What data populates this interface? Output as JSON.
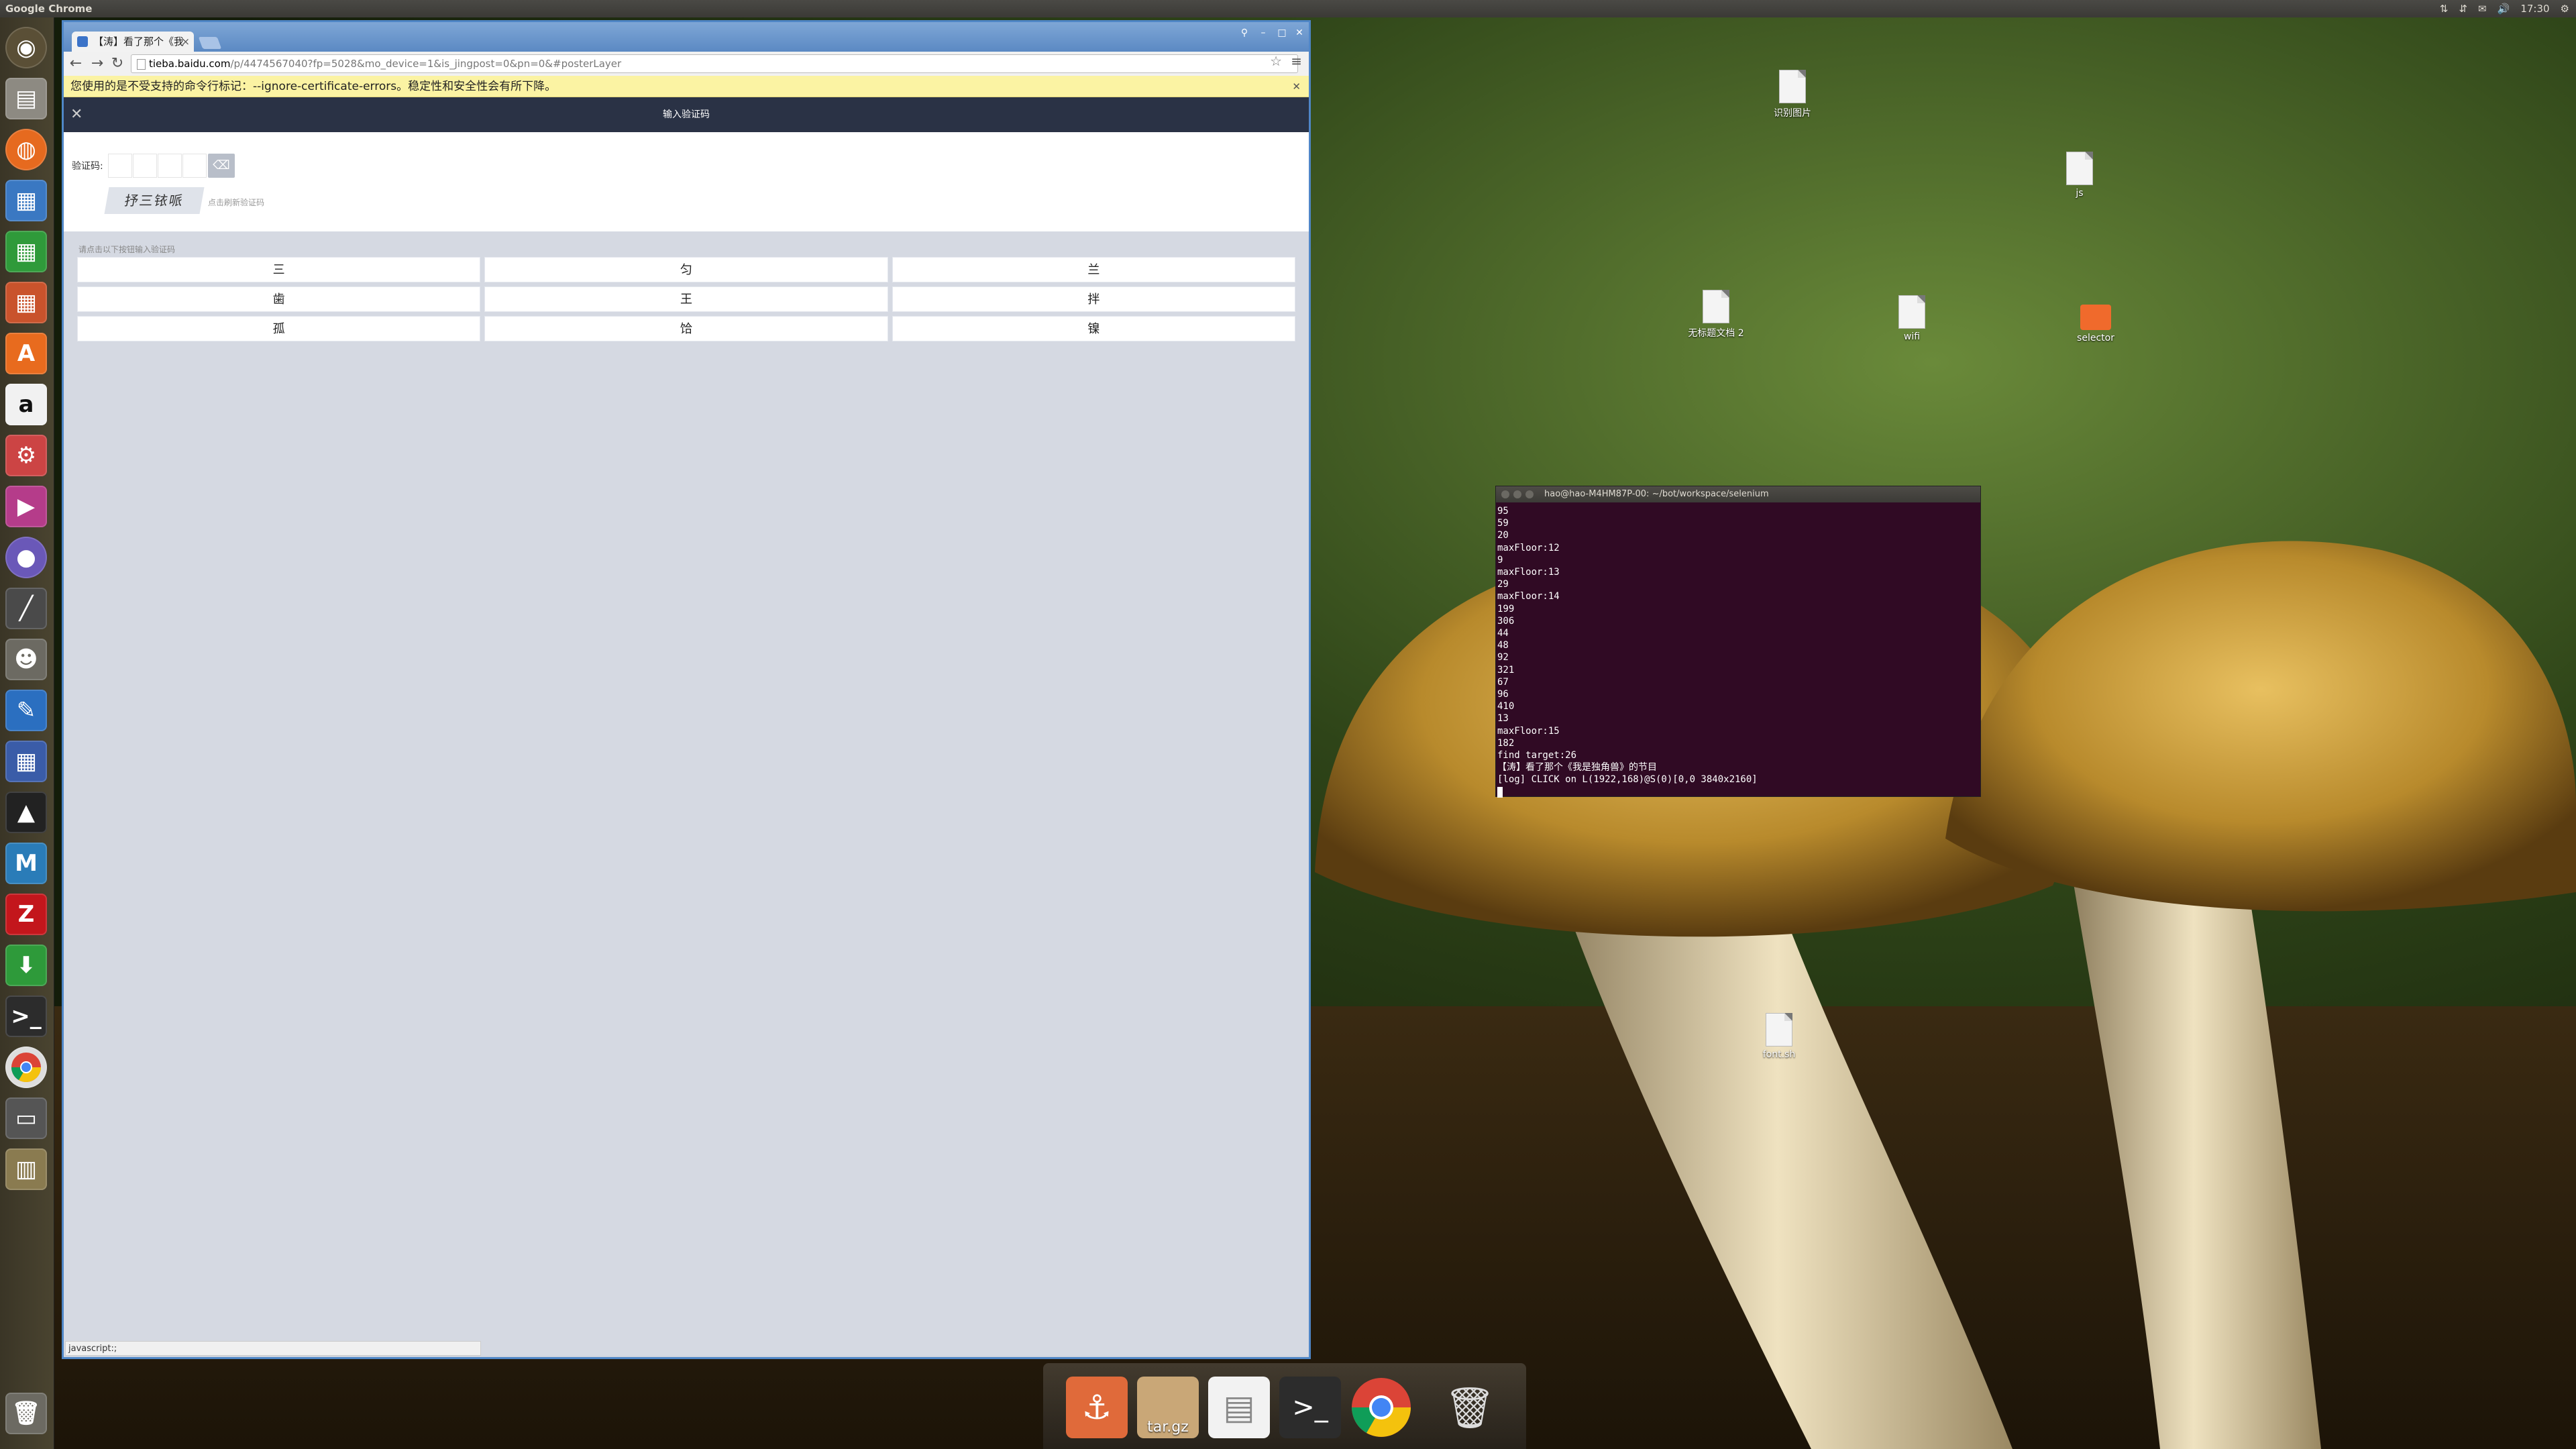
{
  "top_panel": {
    "app_title": "Google Chrome",
    "clock": "17:30",
    "indicators": [
      "network-icon",
      "transfer-icon",
      "mail-icon",
      "volume-icon",
      "gear-icon"
    ]
  },
  "launcher": {
    "items": [
      "dash-home",
      "files",
      "firefox",
      "libreoffice-writer",
      "libreoffice-calc",
      "libreoffice-impress",
      "ubuntu-software",
      "amazon",
      "system-settings",
      "video",
      "disk",
      "screwdriver",
      "gimp",
      "inkscape",
      "calculator",
      "anchor-app",
      "system-monitor",
      "filezilla",
      "download-manager",
      "terminal",
      "chrome",
      "storage",
      "workspace-switcher",
      "trash"
    ]
  },
  "chrome": {
    "tab_title": "【涛】看了那个《我",
    "url_domain": "tieba.baidu.com",
    "url_path": "/p/4474567040?fp=5028&mo_device=1&is_jingpost=0&pn=0&#posterLayer",
    "infobar_text": "您使用的是不受支持的命令行标记：--ignore-certificate-errors。稳定性和安全性会有所下降。",
    "status_text": "javascript:;"
  },
  "captcha": {
    "header_title": "输入验证码",
    "label": "验证码:",
    "image_text": "抒三铱哌",
    "refresh_hint": "点击刷新验证码",
    "grid_hint": "请点击以下按钮输入验证码",
    "chars": [
      "三",
      "匀",
      "兰",
      "歯",
      "王",
      "拌",
      "孤",
      "饸",
      "镍"
    ]
  },
  "desktop_icons": [
    {
      "label": "识别图片"
    },
    {
      "label": "js"
    },
    {
      "label": "无标题文档 2"
    },
    {
      "label": "wifi"
    },
    {
      "label": "selector"
    },
    {
      "label": "font.sh"
    }
  ],
  "terminal": {
    "title": "hao@hao-M4HM87P-00: ~/bot/workspace/selenium",
    "lines": [
      "95",
      "59",
      "20",
      "maxFloor:12",
      "9",
      "maxFloor:13",
      "29",
      "maxFloor:14",
      "199",
      "306",
      "44",
      "48",
      "92",
      "321",
      "67",
      "96",
      "410",
      "13",
      "maxFloor:15",
      "182",
      "find target:26",
      "【涛】看了那个《我是独角兽》的节目",
      "[log] CLICK on L(1922,168)@S(0)[0,0 3840x2160]"
    ]
  },
  "dock": {
    "items": [
      "anchor",
      "tar.gz",
      "document",
      "terminal",
      "chrome",
      "trash"
    ],
    "tar_label": "tar.gz"
  },
  "colors": {
    "chrome_frame": "#4f86c6",
    "captcha_header": "#2a3245",
    "infobar": "#fbf3a3",
    "terminal_bg": "#300a24"
  }
}
